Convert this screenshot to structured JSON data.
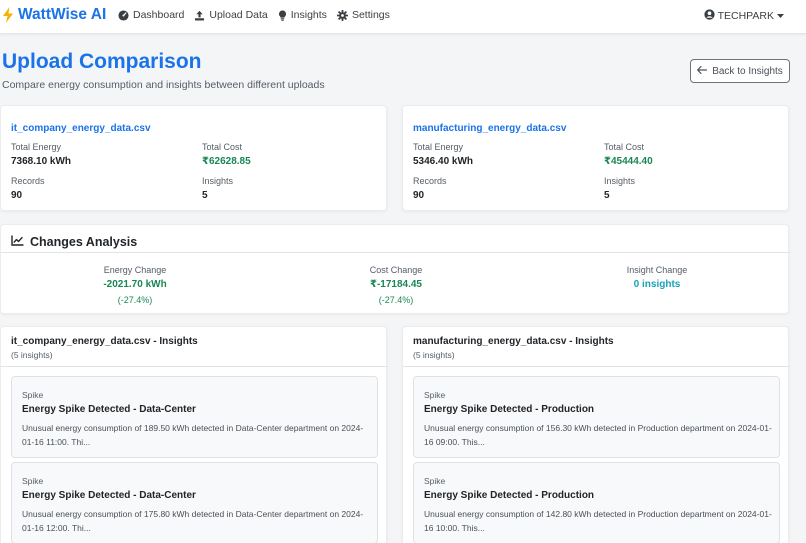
{
  "app": {
    "brand": "WattWise AI",
    "colors": {
      "primary": "#1a73e8",
      "success": "#198754",
      "info": "#17a2b8"
    }
  },
  "nav": {
    "items": [
      {
        "label": "Dashboard",
        "icon": "dashboard-gauge-icon"
      },
      {
        "label": "Upload Data",
        "icon": "upload-icon"
      },
      {
        "label": "Insights",
        "icon": "lightbulb-icon"
      },
      {
        "label": "Settings",
        "icon": "gear-icon"
      }
    ],
    "user": "TECHPARK"
  },
  "page": {
    "title": "Upload Comparison",
    "subtitle": "Compare energy consumption and insights between different uploads",
    "back_label": "Back to Insights"
  },
  "files": [
    {
      "name": "it_company_energy_data.csv",
      "total_energy_label": "Total Energy",
      "total_energy": "7368.10 kWh",
      "total_cost_label": "Total Cost",
      "total_cost": "₹62628.85",
      "records_label": "Records",
      "records": "90",
      "insights_label": "Insights",
      "insights": "5"
    },
    {
      "name": "manufacturing_energy_data.csv",
      "total_energy_label": "Total Energy",
      "total_energy": "5346.40 kWh",
      "total_cost_label": "Total Cost",
      "total_cost": "₹45444.40",
      "records_label": "Records",
      "records": "90",
      "insights_label": "Insights",
      "insights": "5"
    }
  ],
  "changes": {
    "title": "Changes Analysis",
    "energy": {
      "label": "Energy Change",
      "value": "-2021.70 kWh",
      "pct": "(-27.4%)"
    },
    "cost": {
      "label": "Cost Change",
      "value": "₹-17184.45",
      "pct": "(-27.4%)"
    },
    "insight": {
      "label": "Insight Change",
      "value": "0 insights"
    }
  },
  "insight_panels": [
    {
      "title": "it_company_energy_data.csv - Insights",
      "count": "(5 insights)",
      "items": [
        {
          "type": "Spike",
          "title": "Energy Spike Detected - Data-Center",
          "description": "Unusual energy consumption of 189.50 kWh detected in Data-Center department on 2024-01-16 11:00. Thi..."
        },
        {
          "type": "Spike",
          "title": "Energy Spike Detected - Data-Center",
          "description": "Unusual energy consumption of 175.80 kWh detected in Data-Center department on 2024-01-16 12:00. Thi..."
        }
      ]
    },
    {
      "title": "manufacturing_energy_data.csv - Insights",
      "count": "(5 insights)",
      "items": [
        {
          "type": "Spike",
          "title": "Energy Spike Detected - Production",
          "description": "Unusual energy consumption of 156.30 kWh detected in Production department on 2024-01-16 09:00. This..."
        },
        {
          "type": "Spike",
          "title": "Energy Spike Detected - Production",
          "description": "Unusual energy consumption of 142.80 kWh detected in Production department on 2024-01-16 10:00. This..."
        }
      ]
    }
  ]
}
